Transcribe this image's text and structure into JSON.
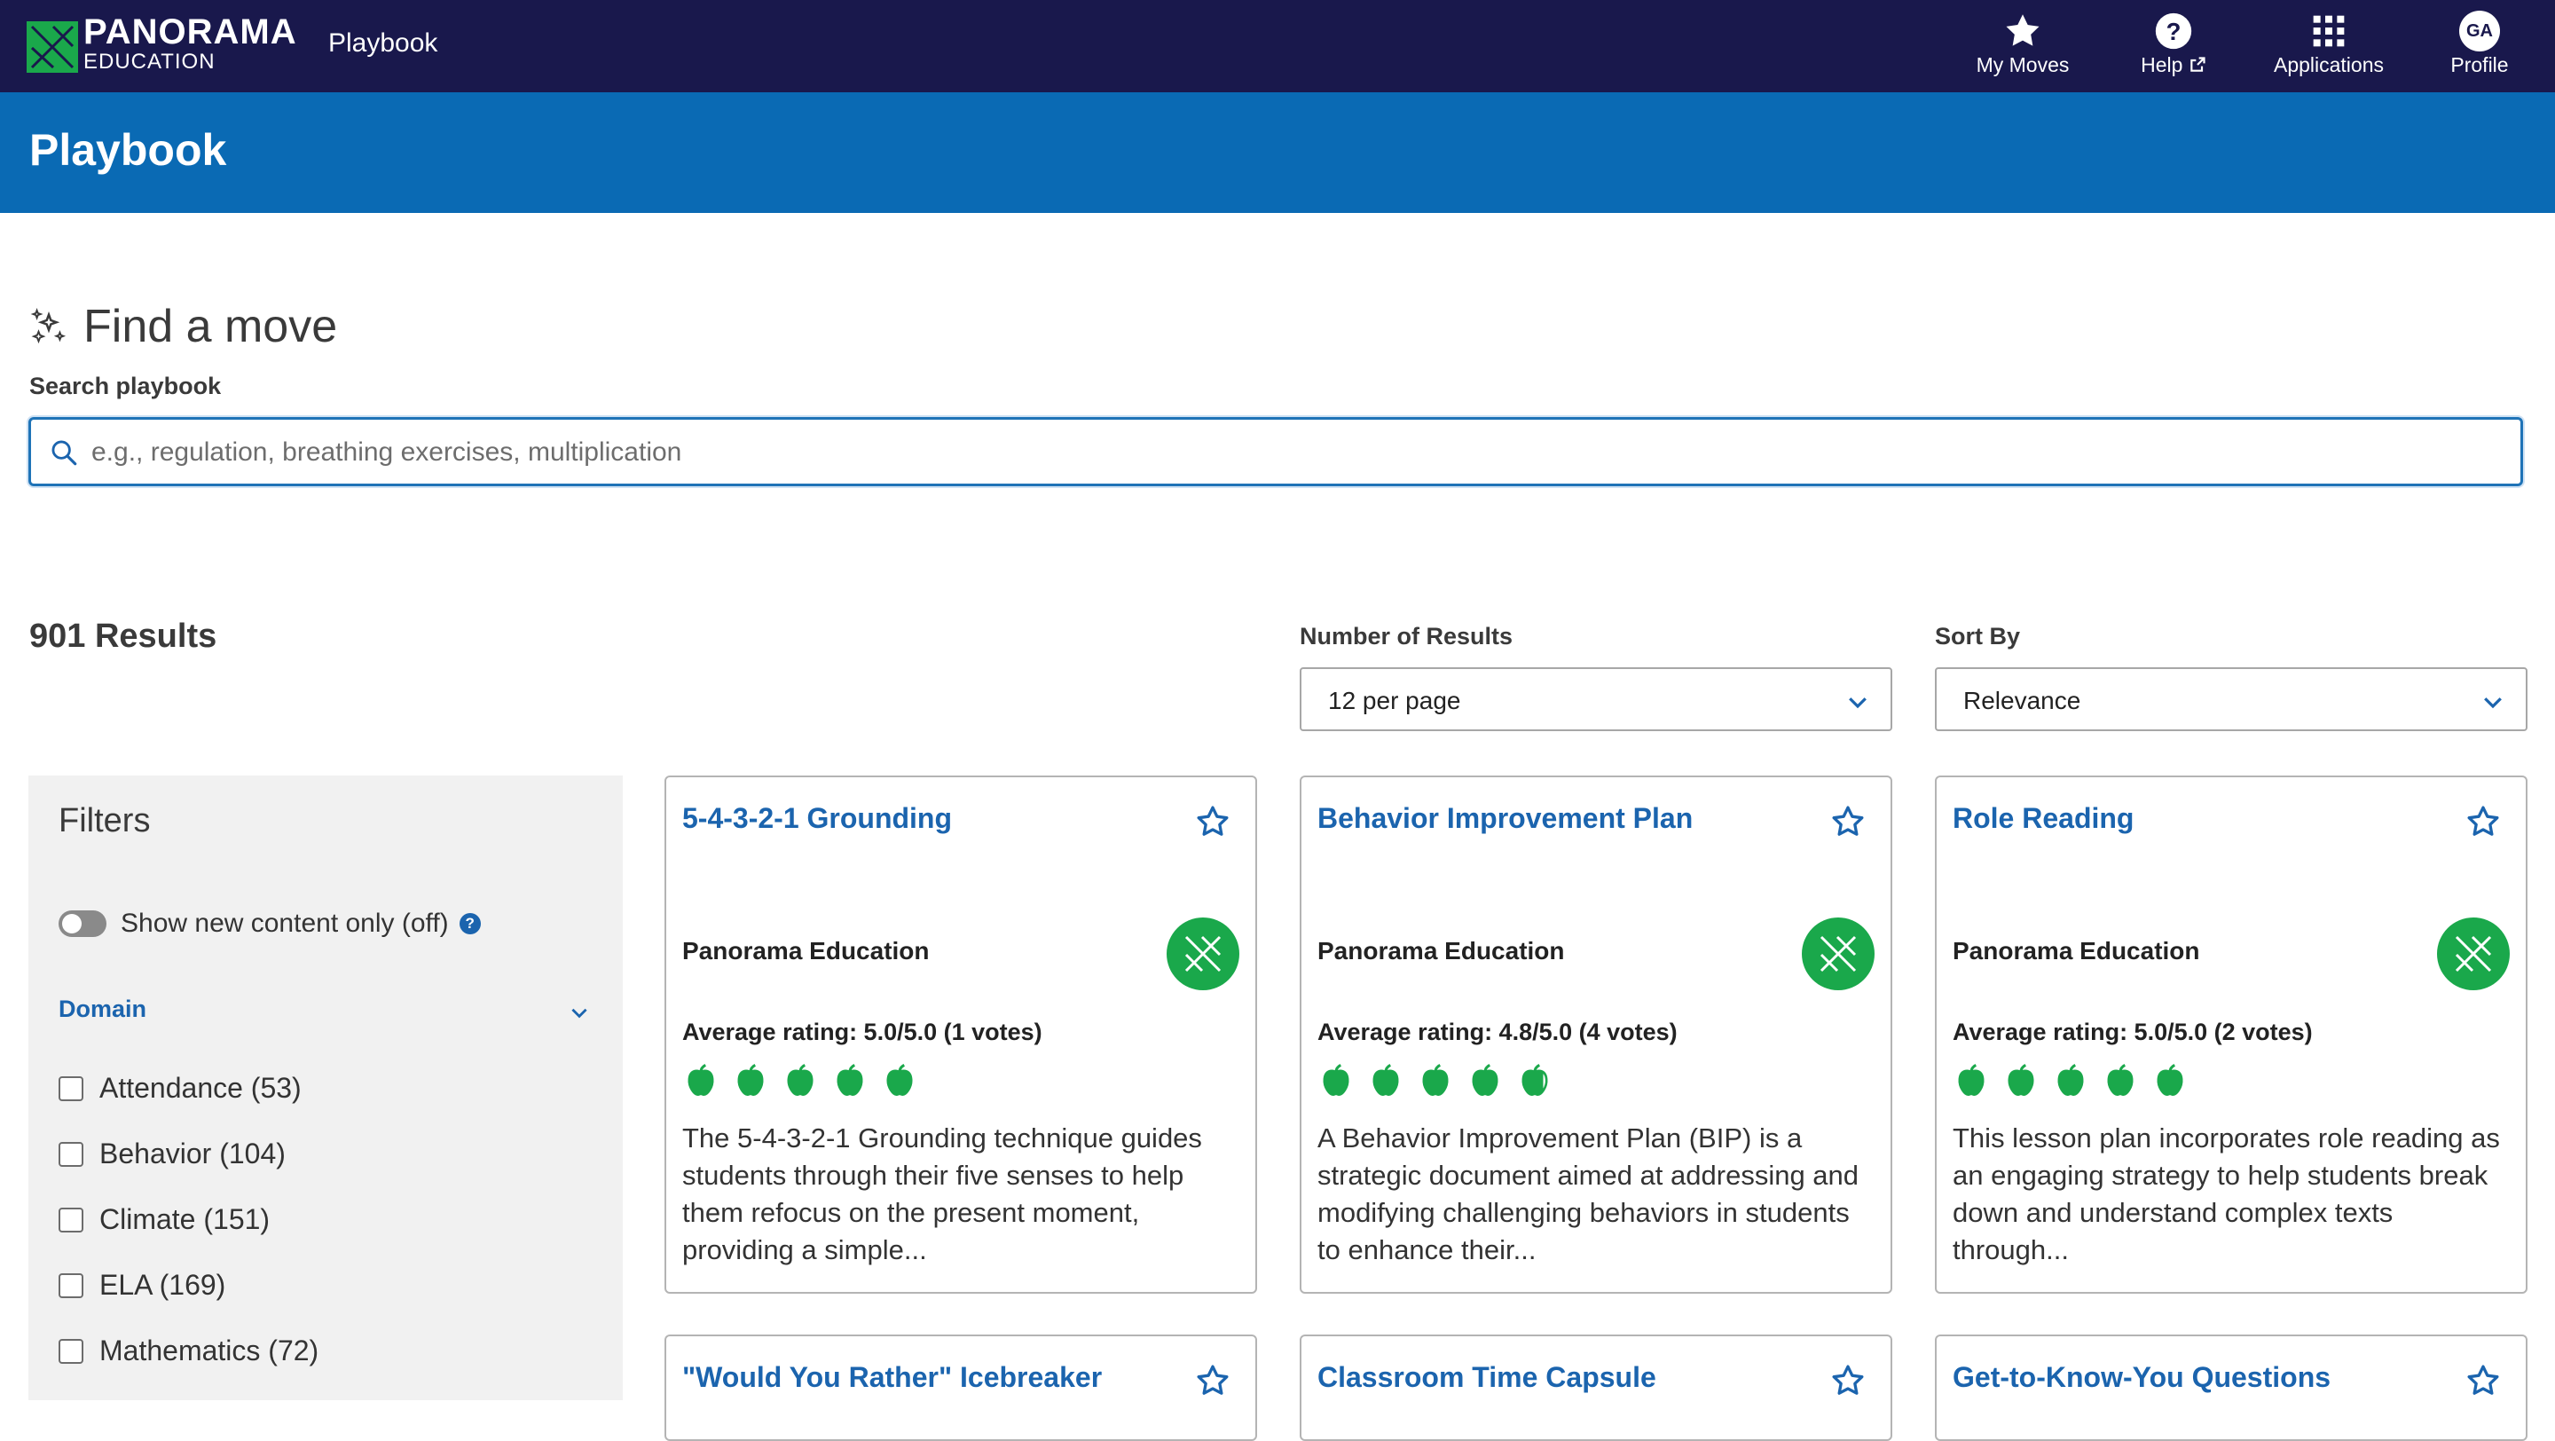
{
  "topbar": {
    "brand_line1": "PANORAMA",
    "brand_line2": "EDUCATION",
    "app_name": "Playbook",
    "nav": [
      {
        "label": "My Moves",
        "icon": "star-icon"
      },
      {
        "label": "Help",
        "icon": "question-circle-icon"
      },
      {
        "label": "Applications",
        "icon": "grid-icon"
      },
      {
        "label": "Profile",
        "icon": "avatar",
        "initials": "GA"
      }
    ]
  },
  "header": {
    "title": "Playbook"
  },
  "search": {
    "heading": "Find a move",
    "label": "Search playbook",
    "placeholder": "e.g., regulation, breathing exercises, multiplication",
    "value": ""
  },
  "results": {
    "count": "901 Results",
    "per_page_label": "Number of Results",
    "per_page_value": "12 per page",
    "sort_label": "Sort By",
    "sort_value": "Relevance"
  },
  "filters": {
    "title": "Filters",
    "toggle_label": "Show new content only (off)",
    "help": "?",
    "domain_label": "Domain",
    "items": [
      {
        "label": "Attendance (53)",
        "checked": false
      },
      {
        "label": "Behavior (104)",
        "checked": false
      },
      {
        "label": "Climate (151)",
        "checked": false
      },
      {
        "label": "ELA (169)",
        "checked": false
      },
      {
        "label": "Mathematics (72)",
        "checked": false
      }
    ]
  },
  "cards": [
    {
      "title": "5-4-3-2-1 Grounding",
      "author": "Panorama Education",
      "rating": "Average rating: 5.0/5.0 (1 votes)",
      "rating_value": 5.0,
      "description": "The 5-4-3-2-1 Grounding technique guides students through their five senses to help them refocus on the present moment, providing a simple..."
    },
    {
      "title": "Behavior Improvement Plan",
      "author": "Panorama Education",
      "rating": "Average rating: 4.8/5.0 (4 votes)",
      "rating_value": 4.8,
      "description": "A Behavior Improvement Plan (BIP) is a strategic document aimed at addressing and modifying challenging behaviors in students to enhance their..."
    },
    {
      "title": "Role Reading",
      "author": "Panorama Education",
      "rating": "Average rating: 5.0/5.0 (2 votes)",
      "rating_value": 5.0,
      "description": "This lesson plan incorporates role reading as an engaging strategy to help students break down and understand complex texts through..."
    },
    {
      "title": "\"Would You Rather\" Icebreaker"
    },
    {
      "title": "Classroom Time Capsule"
    },
    {
      "title": "Get-to-Know-You Questions"
    }
  ],
  "colors": {
    "topbar": "#19184c",
    "header": "#0a6ab4",
    "link": "#1b64ae",
    "apple_green": "#1aa84b"
  }
}
